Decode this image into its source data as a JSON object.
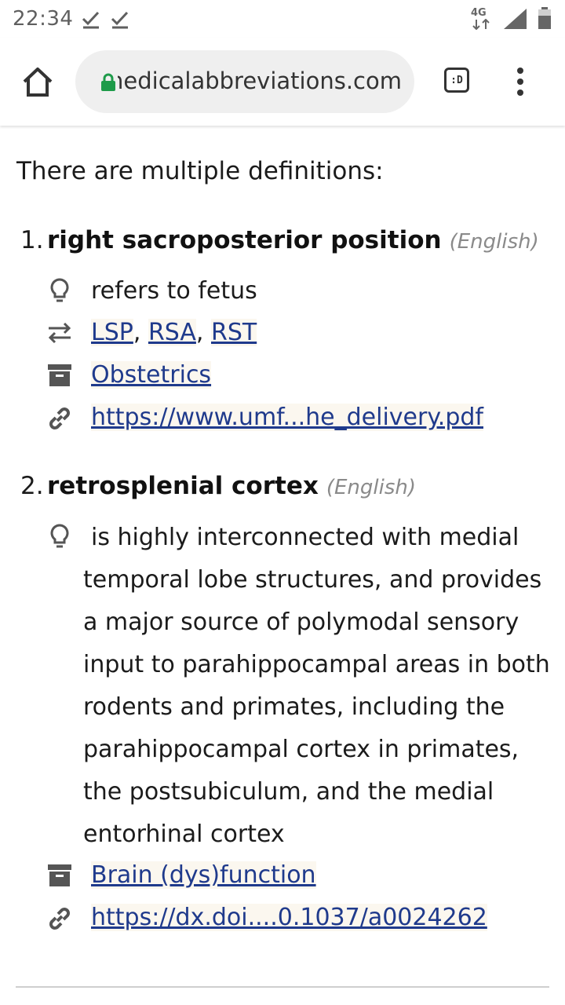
{
  "status_bar": {
    "time": "22:34",
    "network": "4G",
    "icons": [
      "check-icon",
      "check-icon",
      "signal-icon",
      "battery-icon"
    ]
  },
  "browser": {
    "url": "medicalabbreviations.com",
    "url_visible": "edicalabbreviations.com",
    "tab_label": ":D",
    "icons": [
      "home-icon",
      "lock-icon",
      "tab-switcher-icon",
      "overflow-menu-icon"
    ]
  },
  "page": {
    "intro": "There are multiple definitions:",
    "definitions": [
      {
        "number": "1.",
        "term": "right sacroposterior position",
        "language": "(English)",
        "note": "refers to fetus",
        "related": [
          "LSP",
          "RSA",
          "RST"
        ],
        "category": "Obstetrics",
        "source": "https://www.umf...he_delivery.pdf"
      },
      {
        "number": "2.",
        "term": "retrosplenial cortex",
        "language": "(English)",
        "note": " is highly interconnected with medial temporal lobe structures, and provides a major source of polymodal sensory input to parahippocampal areas in both rodents and primates, including the parahippocampal cortex in primates, the postsubiculum, and the medial entorhinal cortex",
        "category": "Brain (dys)function",
        "source": "https://dx.doi....0.1037/a0024262"
      }
    ],
    "separators": [
      ", ",
      ", "
    ]
  },
  "colors": {
    "link": "#1f3a8c",
    "link_bg": "#fbf7ef",
    "lock": "#1e9b4a",
    "muted": "#8a8a8a"
  }
}
